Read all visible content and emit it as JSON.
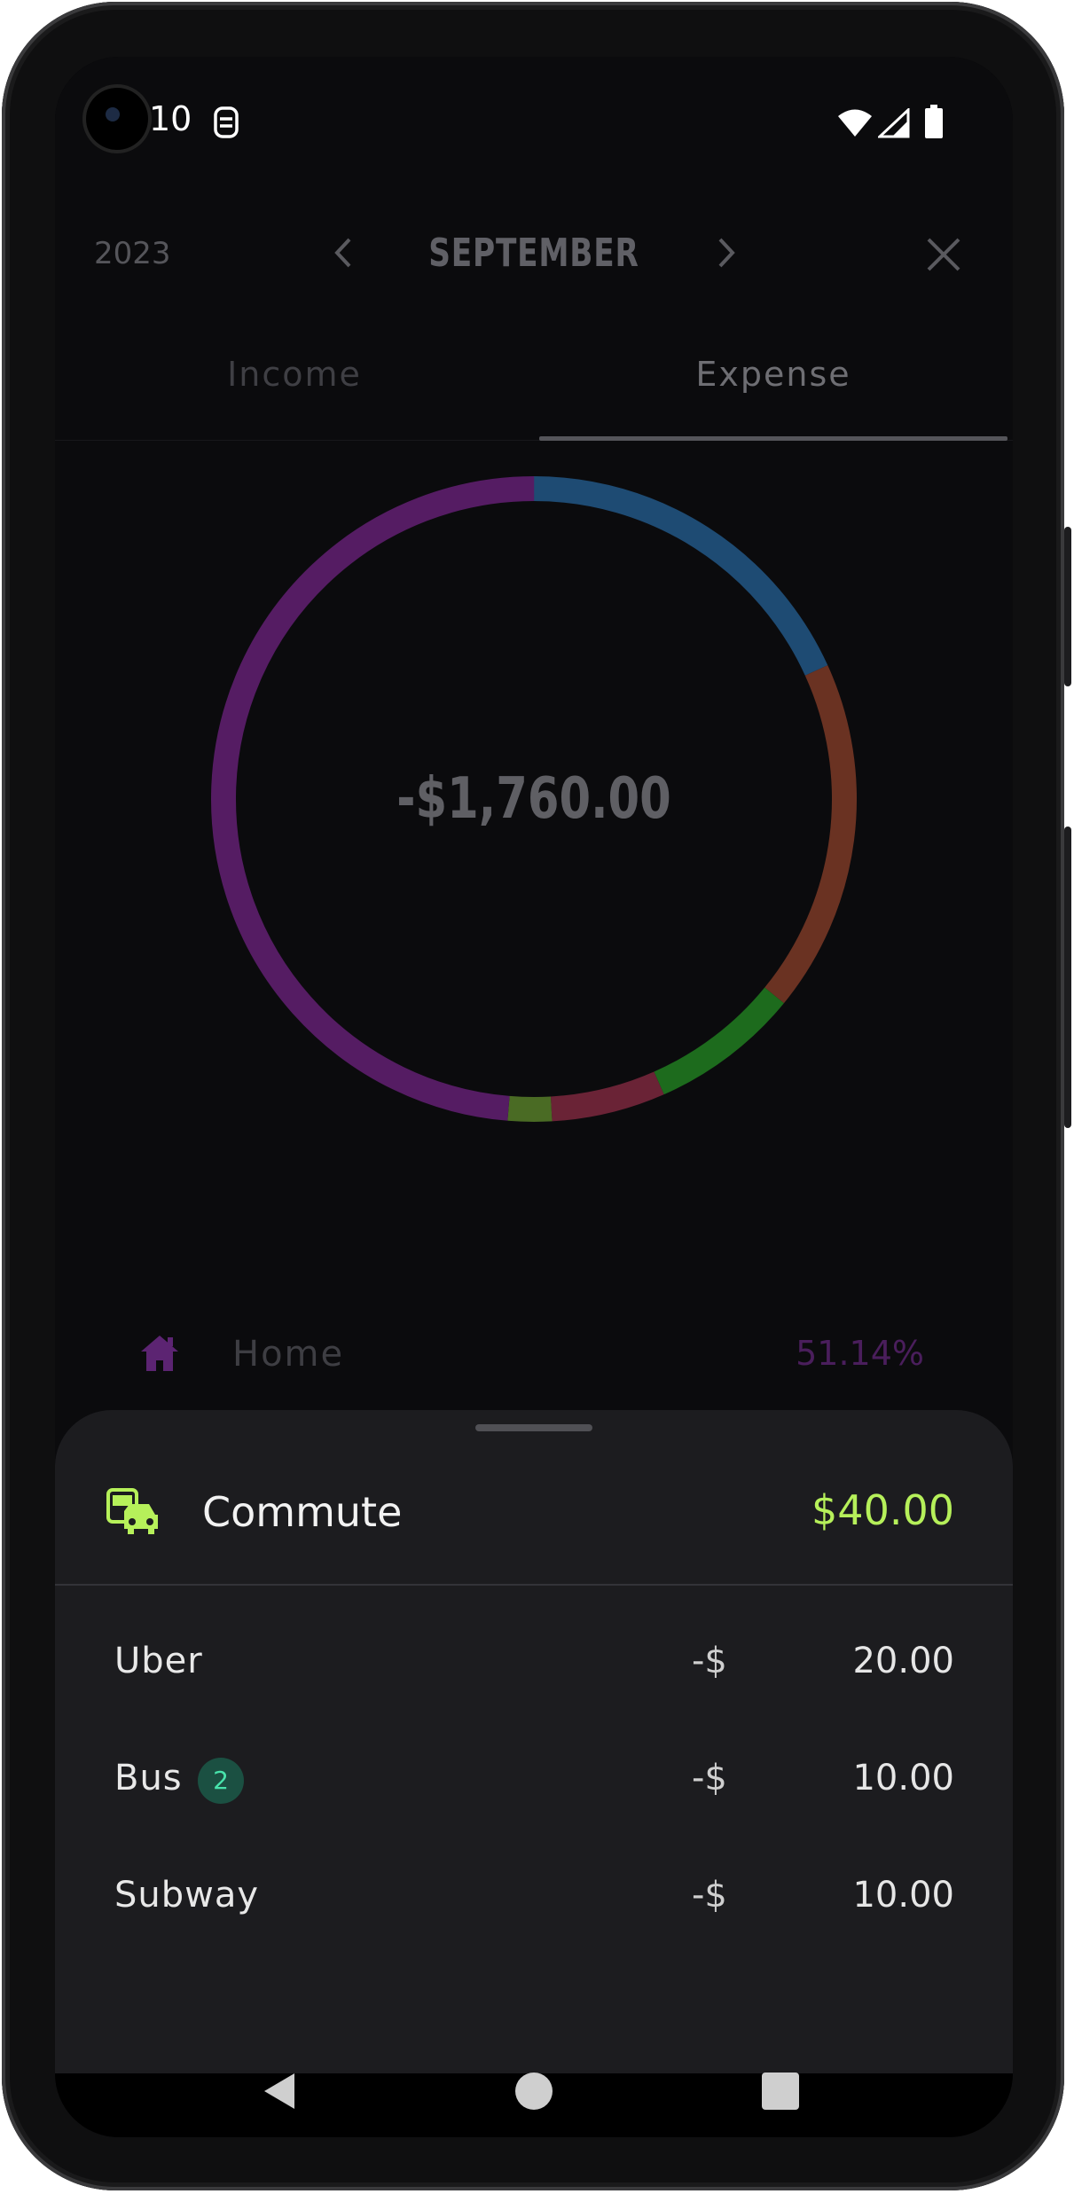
{
  "status_bar": {
    "time": "10"
  },
  "header": {
    "year": "2023",
    "month": "SEPTEMBER"
  },
  "tabs": [
    {
      "label": "Income",
      "active": false
    },
    {
      "label": "Expense",
      "active": true
    }
  ],
  "donut": {
    "total": "-$1,760.00",
    "segments": [
      {
        "color": "#1e4b73",
        "fraction": 0.182
      },
      {
        "color": "#6a3222",
        "fraction": 0.177
      },
      {
        "color": "#1d6b1d",
        "fraction": 0.075
      },
      {
        "color": "#6a2336",
        "fraction": 0.057
      },
      {
        "color": "#4a6b24",
        "fraction": 0.022
      },
      {
        "color": "#551c63",
        "fraction": 0.4871
      }
    ]
  },
  "legend": {
    "label": "Home",
    "percent": "51.14%",
    "color": "#4a1e5c",
    "icon": "home-icon"
  },
  "sheet": {
    "category": "Commute",
    "icon": "commute-icon",
    "amount": "$40.00",
    "amount_color": "#b6f05a",
    "items": [
      {
        "label": "Uber",
        "badge": "",
        "currency": "-$",
        "value": "20.00"
      },
      {
        "label": "Bus",
        "badge": "2",
        "currency": "-$",
        "value": "10.00"
      },
      {
        "label": "Subway",
        "badge": "",
        "currency": "-$",
        "value": "10.00"
      }
    ]
  }
}
